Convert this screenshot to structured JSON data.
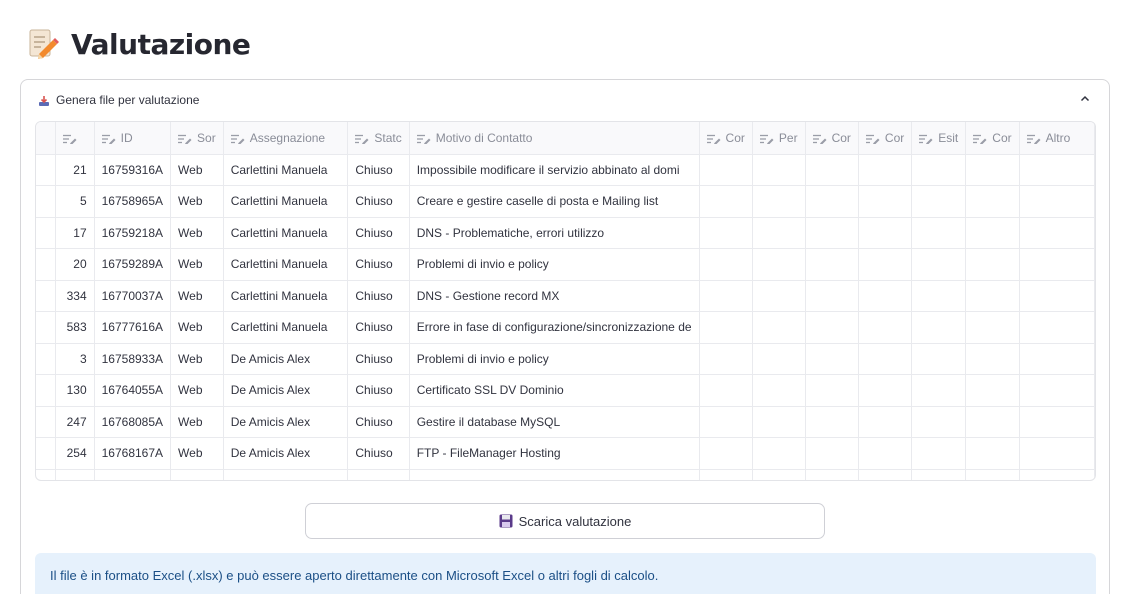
{
  "page": {
    "title": "Valutazione"
  },
  "expander": {
    "label": "Genera file per valutazione"
  },
  "table": {
    "columns": [
      "",
      "ID",
      "Sor",
      "Assegnazione",
      "Statc",
      "Motivo di Contatto",
      "Cor",
      "Per",
      "Cor",
      "Cor",
      "Esit",
      "Cor",
      "Altro"
    ],
    "rows": [
      {
        "index": "21",
        "id": "16759316A",
        "source": "Web",
        "assignee": "Carlettini Manuela",
        "status": "Chiuso",
        "reason": "Impossibile modificare il servizio abbinato al domi"
      },
      {
        "index": "5",
        "id": "16758965A",
        "source": "Web",
        "assignee": "Carlettini Manuela",
        "status": "Chiuso",
        "reason": "Creare e gestire caselle di posta e Mailing list"
      },
      {
        "index": "17",
        "id": "16759218A",
        "source": "Web",
        "assignee": "Carlettini Manuela",
        "status": "Chiuso",
        "reason": "DNS - Problematiche, errori utilizzo"
      },
      {
        "index": "20",
        "id": "16759289A",
        "source": "Web",
        "assignee": "Carlettini Manuela",
        "status": "Chiuso",
        "reason": "Problemi di invio e policy"
      },
      {
        "index": "334",
        "id": "16770037A",
        "source": "Web",
        "assignee": "Carlettini Manuela",
        "status": "Chiuso",
        "reason": "DNS - Gestione record MX"
      },
      {
        "index": "583",
        "id": "16777616A",
        "source": "Web",
        "assignee": "Carlettini Manuela",
        "status": "Chiuso",
        "reason": "Errore in fase di configurazione/sincronizzazione de"
      },
      {
        "index": "3",
        "id": "16758933A",
        "source": "Web",
        "assignee": "De Amicis Alex",
        "status": "Chiuso",
        "reason": "Problemi di invio e policy"
      },
      {
        "index": "130",
        "id": "16764055A",
        "source": "Web",
        "assignee": "De Amicis Alex",
        "status": "Chiuso",
        "reason": "Certificato SSL DV Dominio"
      },
      {
        "index": "247",
        "id": "16768085A",
        "source": "Web",
        "assignee": "De Amicis Alex",
        "status": "Chiuso",
        "reason": "Gestire il database MySQL"
      },
      {
        "index": "254",
        "id": "16768167A",
        "source": "Web",
        "assignee": "De Amicis Alex",
        "status": "Chiuso",
        "reason": "FTP - FileManager Hosting"
      }
    ]
  },
  "download": {
    "label": "Scarica valutazione"
  },
  "info": {
    "text": "Il file è in formato Excel (.xlsx) e può essere aperto direttamente con Microsoft Excel o altri fogli di calcolo."
  }
}
